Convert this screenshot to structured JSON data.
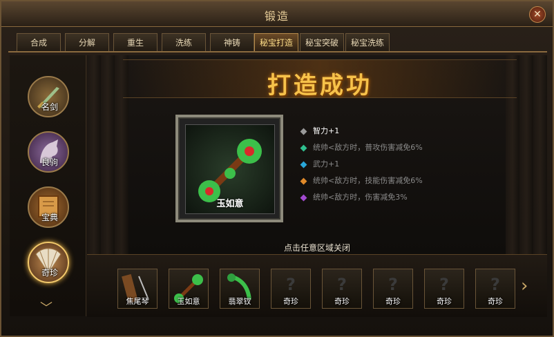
{
  "window": {
    "title": "锻造",
    "close_symbol": "✕"
  },
  "tabs": [
    {
      "label": "合成",
      "active": false
    },
    {
      "label": "分解",
      "active": false
    },
    {
      "label": "重生",
      "active": false
    },
    {
      "label": "洗练",
      "active": false
    },
    {
      "label": "神铸",
      "active": false
    },
    {
      "label": "秘宝打造",
      "active": true
    },
    {
      "label": "秘宝突破",
      "active": false
    },
    {
      "label": "秘宝洗练",
      "active": false
    }
  ],
  "sidebar": {
    "categories": [
      {
        "label": "名剑",
        "icon": "sword-icon",
        "selected": false
      },
      {
        "label": "良驹",
        "icon": "horse-icon",
        "selected": false
      },
      {
        "label": "宝典",
        "icon": "book-icon",
        "selected": false
      },
      {
        "label": "奇珍",
        "icon": "fan-icon",
        "selected": true
      }
    ],
    "more_symbol": "﹀"
  },
  "result": {
    "banner_title": "打造成功",
    "item_name": "玉如意",
    "attributes": [
      {
        "text": "智力+1",
        "color": "#ffffff",
        "gem_color": "#9a9a9a"
      },
      {
        "text": "统帅<敌方时，普攻伤害减免6%",
        "color": "#8a8a8a",
        "gem_color": "#2fbf8f"
      },
      {
        "text": "武力+1",
        "color": "#8a8a8a",
        "gem_color": "#29a6d8"
      },
      {
        "text": "统帅<敌方时，技能伤害减免6%",
        "color": "#8a8a8a",
        "gem_color": "#e08a2a"
      },
      {
        "text": "统帅<敌方时，伤害减免3%",
        "color": "#8a8a8a",
        "gem_color": "#a24ad0"
      }
    ],
    "hint": "点击任意区域关闭"
  },
  "inventory": {
    "slots": [
      {
        "label": "焦尾琴",
        "icon": "guqin-icon",
        "locked": false
      },
      {
        "label": "玉如意",
        "icon": "ruyi-icon",
        "locked": false
      },
      {
        "label": "翡翠钗",
        "icon": "hairpin-icon",
        "locked": false
      },
      {
        "label": "奇珍",
        "icon": "question-icon",
        "locked": true
      },
      {
        "label": "奇珍",
        "icon": "question-icon",
        "locked": true
      },
      {
        "label": "奇珍",
        "icon": "question-icon",
        "locked": true
      },
      {
        "label": "奇珍",
        "icon": "question-icon",
        "locked": true
      },
      {
        "label": "奇珍",
        "icon": "question-icon",
        "locked": true
      }
    ],
    "next_symbol": "›"
  },
  "colors": {
    "gold": "#f7c24a",
    "frame": "#8d8a7b",
    "accent_border": "#b58a4a"
  }
}
